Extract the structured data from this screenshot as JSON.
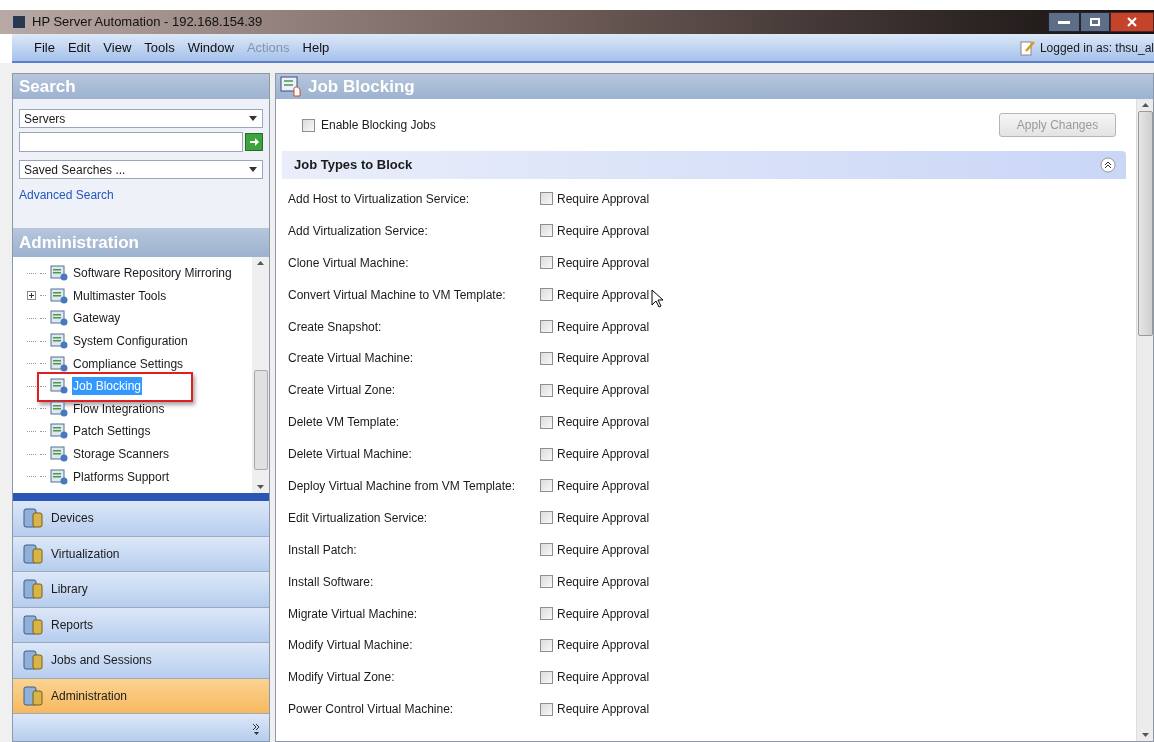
{
  "window": {
    "title": "HP Server Automation - 192.168.154.39"
  },
  "menu": [
    {
      "label": "File",
      "disabled": false
    },
    {
      "label": "Edit",
      "disabled": false
    },
    {
      "label": "View",
      "disabled": false
    },
    {
      "label": "Tools",
      "disabled": false
    },
    {
      "label": "Window",
      "disabled": false
    },
    {
      "label": "Actions",
      "disabled": true
    },
    {
      "label": "Help",
      "disabled": false
    }
  ],
  "login": "Logged in as: thsu_al",
  "search": {
    "title": "Search",
    "scope": "Servers",
    "saved": "Saved Searches ...",
    "advanced": "Advanced Search"
  },
  "admin": {
    "title": "Administration",
    "items": [
      {
        "label": "Software Repository Mirroring",
        "selected": false,
        "expandable": false
      },
      {
        "label": "Multimaster Tools",
        "selected": false,
        "expandable": true
      },
      {
        "label": "Gateway",
        "selected": false,
        "expandable": false
      },
      {
        "label": "System Configuration",
        "selected": false,
        "expandable": false
      },
      {
        "label": "Compliance Settings",
        "selected": false,
        "expandable": false
      },
      {
        "label": "Job Blocking",
        "selected": true,
        "expandable": false
      },
      {
        "label": "Flow Integrations",
        "selected": false,
        "expandable": false
      },
      {
        "label": "Patch Settings",
        "selected": false,
        "expandable": false
      },
      {
        "label": "Storage Scanners",
        "selected": false,
        "expandable": false
      },
      {
        "label": "Platforms Support",
        "selected": false,
        "expandable": false
      }
    ]
  },
  "nav": [
    {
      "label": "Devices",
      "selected": false
    },
    {
      "label": "Virtualization",
      "selected": false
    },
    {
      "label": "Library",
      "selected": false
    },
    {
      "label": "Reports",
      "selected": false
    },
    {
      "label": "Jobs and Sessions",
      "selected": false
    },
    {
      "label": "Administration",
      "selected": true
    }
  ],
  "content": {
    "title": "Job Blocking",
    "enable": {
      "label": "Enable Blocking Jobs",
      "checked": false
    },
    "apply": {
      "label": "Apply Changes",
      "disabled": true
    },
    "section": "Job Types to Block",
    "rows": [
      {
        "label": "Add Host to Virtualization Service:",
        "option": "Require Approval",
        "checked": false
      },
      {
        "label": "Add Virtualization Service:",
        "option": "Require Approval",
        "checked": false
      },
      {
        "label": "Clone Virtual Machine:",
        "option": "Require Approval",
        "checked": false
      },
      {
        "label": "Convert Virtual Machine to VM Template:",
        "option": "Require Approval",
        "checked": false
      },
      {
        "label": "Create Snapshot:",
        "option": "Require Approval",
        "checked": false
      },
      {
        "label": "Create Virtual Machine:",
        "option": "Require Approval",
        "checked": false
      },
      {
        "label": "Create Virtual Zone:",
        "option": "Require Approval",
        "checked": false
      },
      {
        "label": "Delete VM Template:",
        "option": "Require Approval",
        "checked": false
      },
      {
        "label": "Delete Virtual Machine:",
        "option": "Require Approval",
        "checked": false
      },
      {
        "label": "Deploy Virtual Machine from VM Template:",
        "option": "Require Approval",
        "checked": false
      },
      {
        "label": "Edit Virtualization Service:",
        "option": "Require Approval",
        "checked": false
      },
      {
        "label": "Install Patch:",
        "option": "Require Approval",
        "checked": false
      },
      {
        "label": "Install Software:",
        "option": "Require Approval",
        "checked": false
      },
      {
        "label": "Migrate Virtual Machine:",
        "option": "Require Approval",
        "checked": false
      },
      {
        "label": "Modify Virtual Machine:",
        "option": "Require Approval",
        "checked": false
      },
      {
        "label": "Modify Virtual Zone:",
        "option": "Require Approval",
        "checked": false
      },
      {
        "label": "Power Control Virtual Machine:",
        "option": "Require Approval",
        "checked": false
      }
    ]
  }
}
